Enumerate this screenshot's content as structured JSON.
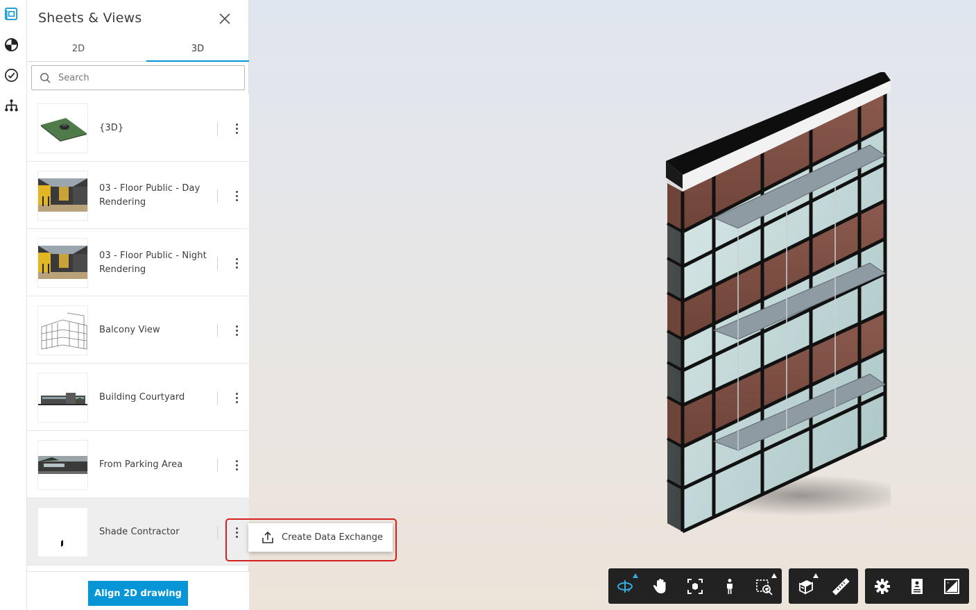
{
  "panel": {
    "title": "Sheets & Views",
    "tabs": [
      {
        "label": "2D",
        "active": false
      },
      {
        "label": "3D",
        "active": true
      }
    ],
    "search_placeholder": "Search",
    "items": [
      {
        "label": "{3D}",
        "thumb": "3d-site-thumbnail",
        "selected": false
      },
      {
        "label": "03 - Floor Public - Day Rendering",
        "thumb": "interior-rendering-thumbnail",
        "selected": false
      },
      {
        "label": "03 - Floor Public - Night Rendering",
        "thumb": "interior-rendering-thumbnail",
        "selected": false
      },
      {
        "label": "Balcony View",
        "thumb": "balcony-wireframe-thumbnail",
        "selected": false
      },
      {
        "label": "Building Courtyard",
        "thumb": "courtyard-thumbnail",
        "selected": false
      },
      {
        "label": "From Parking Area",
        "thumb": "parking-thumbnail",
        "selected": false
      },
      {
        "label": "Shade Contractor",
        "thumb": "shade-thumbnail",
        "selected": true
      }
    ],
    "align_button": "Align 2D drawing"
  },
  "context_menu": {
    "items": [
      {
        "label": "Create Data Exchange",
        "icon": "share-upload-icon"
      }
    ]
  },
  "rail": {
    "icons": [
      "sheets-views-icon",
      "model-browser-icon",
      "issues-check-icon",
      "hierarchy-icon"
    ]
  },
  "toolbar": {
    "groups": [
      [
        "orbit-icon",
        "pan-icon",
        "fit-view-icon",
        "first-person-icon",
        "zoom-window-icon"
      ],
      [
        "section-box-icon",
        "measure-icon"
      ],
      [
        "settings-icon",
        "properties-icon",
        "fullscreen-icon"
      ]
    ]
  },
  "colors": {
    "accent": "#0696d7",
    "highlight": "#d61f1f",
    "toolbar_bg": "#222222"
  }
}
